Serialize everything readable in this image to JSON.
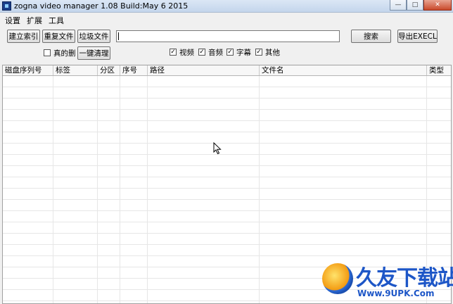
{
  "window": {
    "title": "zogna video manager 1.08 Build:May  6 2015",
    "minimize_symbol": "—",
    "maximize_symbol": "□",
    "close_symbol": "✕"
  },
  "menu": [
    "设置",
    "扩展",
    "工具"
  ],
  "toolbar": {
    "build_index": "建立索引",
    "duplicate_files": "重复文件",
    "junk_files": "垃圾文件",
    "search_value": "",
    "search": "搜索",
    "export_excel": "导出EXECL",
    "really_delete": "真的删",
    "one_click_clean": "一键清理"
  },
  "filters": [
    {
      "label": "视频",
      "checked": true
    },
    {
      "label": "音频",
      "checked": true
    },
    {
      "label": "字幕",
      "checked": true
    },
    {
      "label": "其他",
      "checked": true
    }
  ],
  "check_mark": "✓",
  "table": {
    "columns": [
      "磁盘序列号",
      "标签",
      "分区",
      "序号",
      "路径",
      "文件名",
      "类型"
    ],
    "rows": []
  },
  "watermark": {
    "text": "久友下载站",
    "url": "Www.9UPK.Com"
  }
}
